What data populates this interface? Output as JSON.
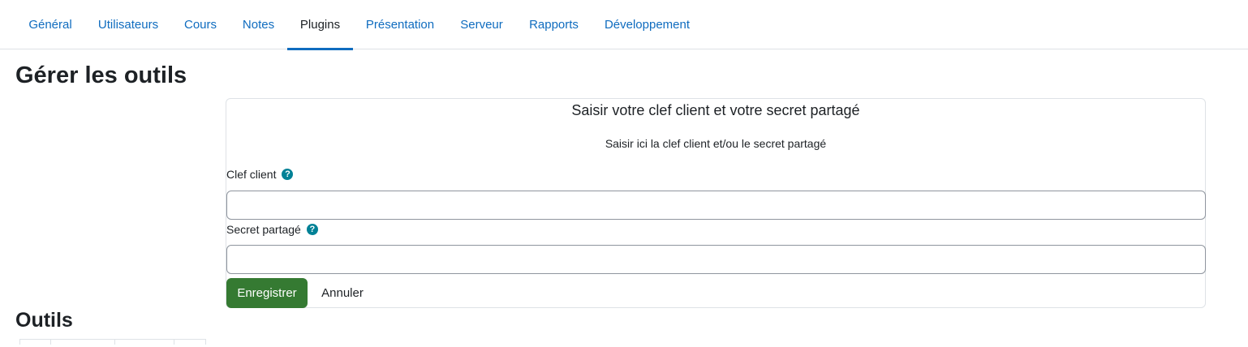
{
  "nav": {
    "tabs": [
      {
        "label": "Général",
        "active": false
      },
      {
        "label": "Utilisateurs",
        "active": false
      },
      {
        "label": "Cours",
        "active": false
      },
      {
        "label": "Notes",
        "active": false
      },
      {
        "label": "Plugins",
        "active": true
      },
      {
        "label": "Présentation",
        "active": false
      },
      {
        "label": "Serveur",
        "active": false
      },
      {
        "label": "Rapports",
        "active": false
      },
      {
        "label": "Développement",
        "active": false
      }
    ]
  },
  "page": {
    "title": "Gérer les outils"
  },
  "form": {
    "title": "Saisir votre clef client et votre secret partagé",
    "description": "Saisir ici la clef client et/ou le secret partagé",
    "consumer_key": {
      "label": "Clef client",
      "value": "",
      "help_icon": "question-circle-icon"
    },
    "shared_secret": {
      "label": "Secret partagé",
      "value": "",
      "help_icon": "question-circle-icon"
    },
    "save_label": "Enregistrer",
    "cancel_label": "Annuler"
  },
  "tools": {
    "title": "Outils"
  },
  "colors": {
    "link": "#0f6cbf",
    "primary_button": "#357a32",
    "help_icon": "#008196",
    "text": "#1d2125"
  }
}
